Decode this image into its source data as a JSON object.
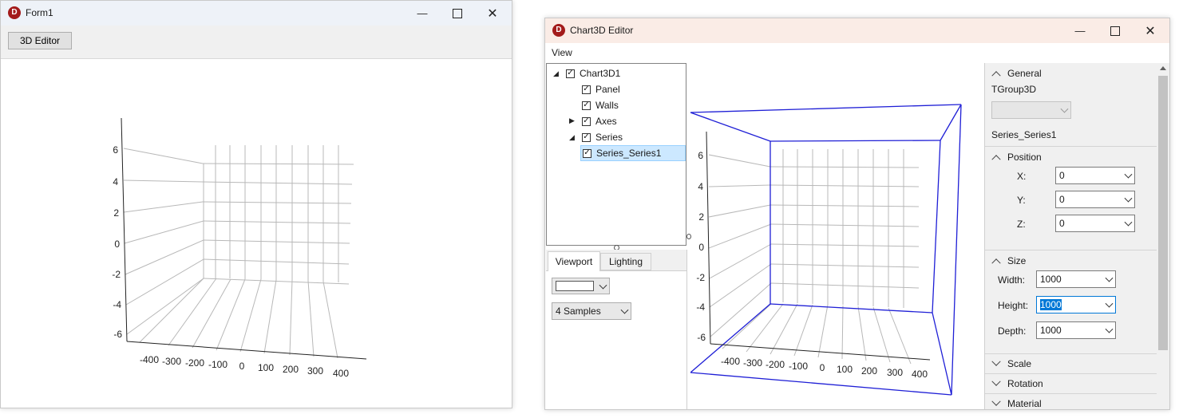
{
  "form1": {
    "title": "Form1",
    "button_label": "3D Editor",
    "chart": {
      "y_ticks": [
        "6",
        "4",
        "2",
        "0",
        "-2",
        "-4",
        "-6"
      ],
      "x_ticks": [
        "-400",
        "-300",
        "-200",
        "-100",
        "0",
        "100",
        "200",
        "300",
        "400"
      ]
    }
  },
  "editor": {
    "title": "Chart3D Editor",
    "menu_view": "View",
    "tree": [
      {
        "label": "Chart3D1",
        "level": 0,
        "expander": "expanded",
        "checked": true
      },
      {
        "label": "Panel",
        "level": 1,
        "expander": "none",
        "checked": true
      },
      {
        "label": "Walls",
        "level": 1,
        "expander": "none",
        "checked": true
      },
      {
        "label": "Axes",
        "level": 1,
        "expander": "collapsed",
        "checked": true
      },
      {
        "label": "Series",
        "level": 1,
        "expander": "expanded",
        "checked": true
      },
      {
        "label": "Series_Series1",
        "level": 2,
        "expander": "none",
        "checked": true,
        "selected": true
      }
    ],
    "tabs": {
      "viewport": "Viewport",
      "lighting": "Lighting"
    },
    "viewport": {
      "color_combo": "",
      "samples_combo": "4 Samples"
    },
    "chart": {
      "y_ticks": [
        "6",
        "4",
        "2",
        "0",
        "-2",
        "-4",
        "-6"
      ],
      "x_ticks": [
        "-400",
        "-300",
        "-200",
        "-100",
        "0",
        "100",
        "200",
        "300",
        "400"
      ]
    },
    "props": {
      "general_header": "General",
      "class_name": "TGroup3D",
      "general_combo": "",
      "object_name": "Series_Series1",
      "position_header": "Position",
      "x_label": "X:",
      "x_value": "0",
      "y_label": "Y:",
      "y_value": "0",
      "z_label": "Z:",
      "z_value": "0",
      "size_header": "Size",
      "width_label": "Width:",
      "width_value": "1000",
      "height_label": "Height:",
      "height_value": "1000",
      "depth_label": "Depth:",
      "depth_value": "1000",
      "scale_header": "Scale",
      "rotation_header": "Rotation",
      "material_header": "Material"
    }
  },
  "colors": {
    "wall_outline": "#1f1fd6",
    "grid": "#b8b8b8",
    "selection": "#cce8ff",
    "icon": "#a31b1b"
  }
}
